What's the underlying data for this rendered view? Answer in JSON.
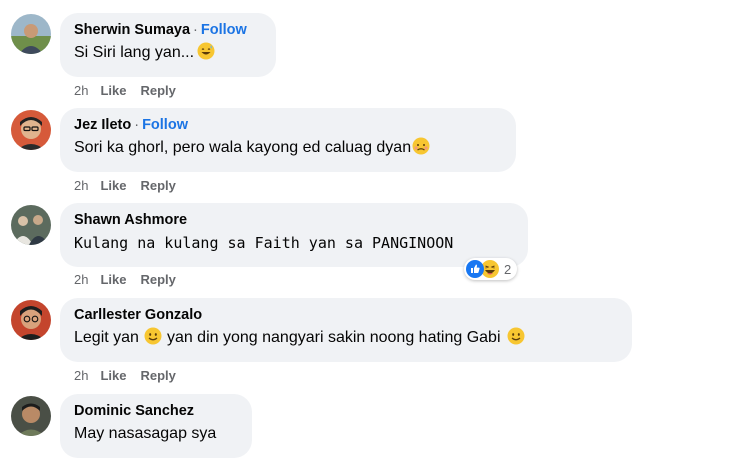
{
  "comments": [
    {
      "author": "Sherwin Sumaya",
      "follow_label": "Follow",
      "separator": "·",
      "text": "Si Siri lang yan...",
      "emoji": "grinning-sweat-emoji",
      "age": "2h",
      "like_label": "Like",
      "reply_label": "Reply"
    },
    {
      "author": "Jez Ileto",
      "follow_label": "Follow",
      "separator": "·",
      "text": "Sori ka ghorl, pero wala kayong ed caluag dyan",
      "emoji": "disappointed-face-emoji",
      "age": "2h",
      "like_label": "Like",
      "reply_label": "Reply"
    },
    {
      "author": "Shawn Ashmore",
      "text": "Kulang na kulang sa Faith yan sa PANGINOON",
      "age": "2h",
      "like_label": "Like",
      "reply_label": "Reply",
      "reactions": {
        "icons": [
          "like-reaction-icon",
          "haha-reaction-icon"
        ],
        "count": "2"
      }
    },
    {
      "author": "Carllester Gonzalo",
      "text_before": "Legit yan",
      "text_after": "yan din yong nangyari sakin noong hating Gabi",
      "emoji": "slightly-smiling-face-emoji",
      "age": "2h",
      "like_label": "Like",
      "reply_label": "Reply"
    },
    {
      "author": "Dominic Sanchez",
      "text": "May nasasagap sya"
    }
  ],
  "colors": {
    "bubble": "#f0f2f5",
    "follow": "#1b74e4",
    "meta": "#65676b",
    "like_blue": "#1877f2",
    "emoji_yellow": "#f7c631"
  }
}
